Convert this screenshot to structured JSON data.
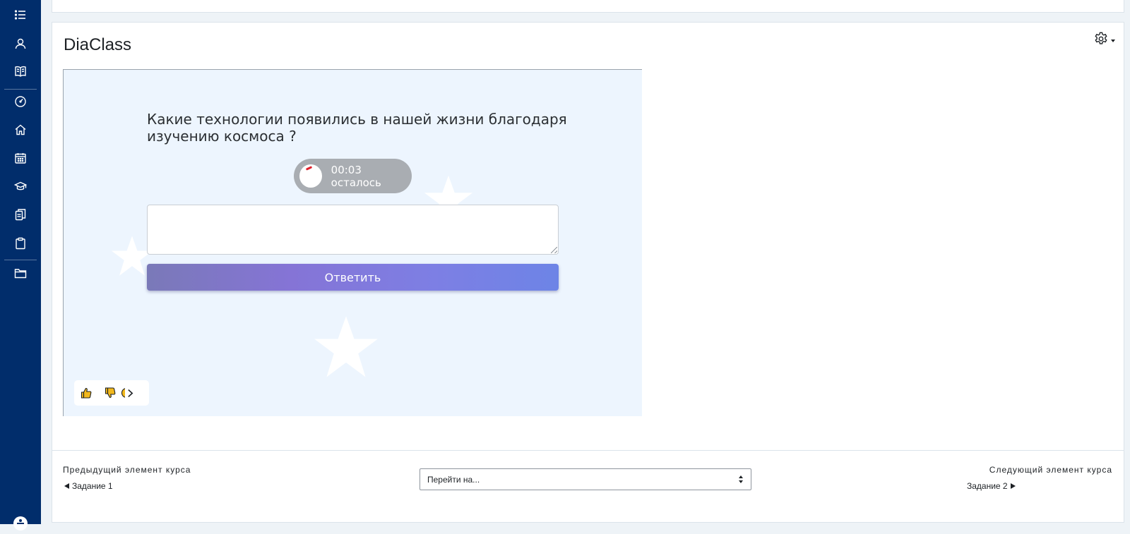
{
  "nav_rail": {
    "items": [
      {
        "icon": "list-icon"
      },
      {
        "icon": "participants-icon"
      },
      {
        "icon": "book-icon"
      },
      {
        "icon": "dashboard-icon"
      },
      {
        "icon": "home-icon"
      },
      {
        "icon": "calendar-icon"
      },
      {
        "icon": "graduation-cap-icon"
      },
      {
        "icon": "files-icon"
      },
      {
        "icon": "clipboard-icon"
      },
      {
        "icon": "folder-icon"
      }
    ],
    "bg_color": "#012d6b"
  },
  "activity": {
    "title": "DiaClass",
    "question": "Какие технологии появились в нашей жизни благодаря изучению космоса ?",
    "timer_text": "00:03 осталось",
    "answer_value": "",
    "submit_label": "Ответить",
    "accent_color": "#7d7fe4"
  },
  "footer": {
    "prev_label": "Предыдущий элемент курса",
    "prev_link": "Задание 1",
    "jump_placeholder": "Перейти на...",
    "next_label": "Следующий элемент курса",
    "next_link": "Задание 2"
  }
}
